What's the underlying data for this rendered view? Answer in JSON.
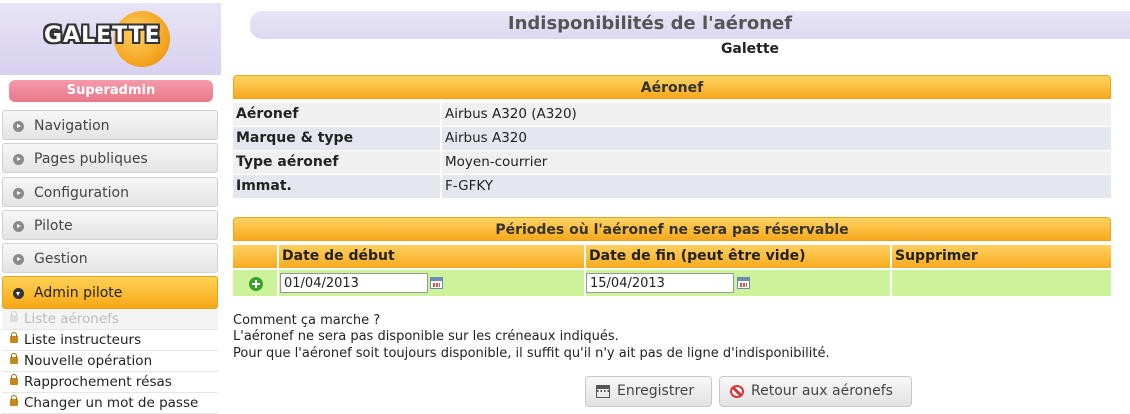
{
  "logo": {
    "text": "GALETTE"
  },
  "sidebar": {
    "role": "Superadmin",
    "items": [
      {
        "label": "Navigation"
      },
      {
        "label": "Pages publiques"
      },
      {
        "label": "Configuration"
      },
      {
        "label": "Pilote"
      },
      {
        "label": "Gestion"
      },
      {
        "label": "Admin pilote",
        "active": true
      }
    ],
    "subitems": [
      {
        "label": "Liste aéronefs",
        "disabled": true
      },
      {
        "label": "Liste instructeurs"
      },
      {
        "label": "Nouvelle opération"
      },
      {
        "label": "Rapprochement résas"
      },
      {
        "label": "Changer un mot de passe"
      }
    ]
  },
  "header": {
    "title": "Indisponibilités de l'aéronef",
    "subtitle": "Galette"
  },
  "aircraft": {
    "section_title": "Aéronef",
    "rows": [
      {
        "label": "Aéronef",
        "value": "Airbus A320 (A320)"
      },
      {
        "label": "Marque & type",
        "value": "Airbus A320"
      },
      {
        "label": "Type aéronef",
        "value": "Moyen-courrier"
      },
      {
        "label": "Immat.",
        "value": "F-GFKY"
      }
    ]
  },
  "periods": {
    "section_title": "Périodes où l'aéronef ne sera pas réservable",
    "columns": [
      "Date de début",
      "Date de fin (peut être vide)",
      "Supprimer"
    ],
    "row": {
      "start": "01/04/2013",
      "end": "15/04/2013"
    }
  },
  "help": {
    "line1": "Comment ça marche ?",
    "line2": "L'aéronef ne sera pas disponible sur les créneaux indiqués.",
    "line3": "Pour que l'aéronef soit toujours disponible, il suffit qu'il n'y ait pas de ligne d'indisponibilité."
  },
  "buttons": {
    "save": "Enregistrer",
    "back": "Retour aux aéronefs"
  },
  "colors": {
    "accent_orange": "#f8a81c",
    "row_green": "#cdf39a",
    "role_pink": "#e8788a"
  }
}
